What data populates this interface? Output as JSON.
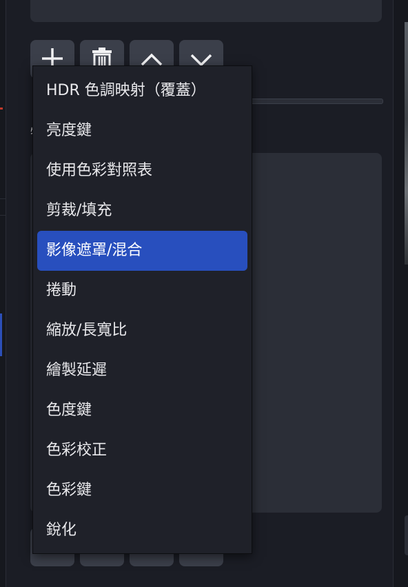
{
  "toolbar": {
    "buttons": [
      {
        "name": "add",
        "icon": "plus-icon"
      },
      {
        "name": "remove",
        "icon": "trash-icon"
      },
      {
        "name": "move-up",
        "icon": "chevron-up-icon"
      },
      {
        "name": "move-down",
        "icon": "chevron-down-icon"
      }
    ]
  },
  "side_label": "特",
  "menu": {
    "items": [
      {
        "label": "HDR 色調映射（覆蓋）"
      },
      {
        "label": "亮度鍵"
      },
      {
        "label": "使用色彩對照表"
      },
      {
        "label": "剪裁/填充"
      },
      {
        "label": "影像遮罩/混合",
        "highlighted": true
      },
      {
        "label": "捲動"
      },
      {
        "label": "縮放/長寬比"
      },
      {
        "label": "繪製延遲"
      },
      {
        "label": "色度鍵"
      },
      {
        "label": "色彩校正"
      },
      {
        "label": "色彩鍵"
      },
      {
        "label": "銳化"
      }
    ]
  },
  "colors": {
    "background": "#1b1d25",
    "panel": "#2b2e37",
    "button": "#3b3f4a",
    "menu_bg": "#1f2129",
    "highlight": "#284fbe",
    "text": "#e9e9ec"
  }
}
